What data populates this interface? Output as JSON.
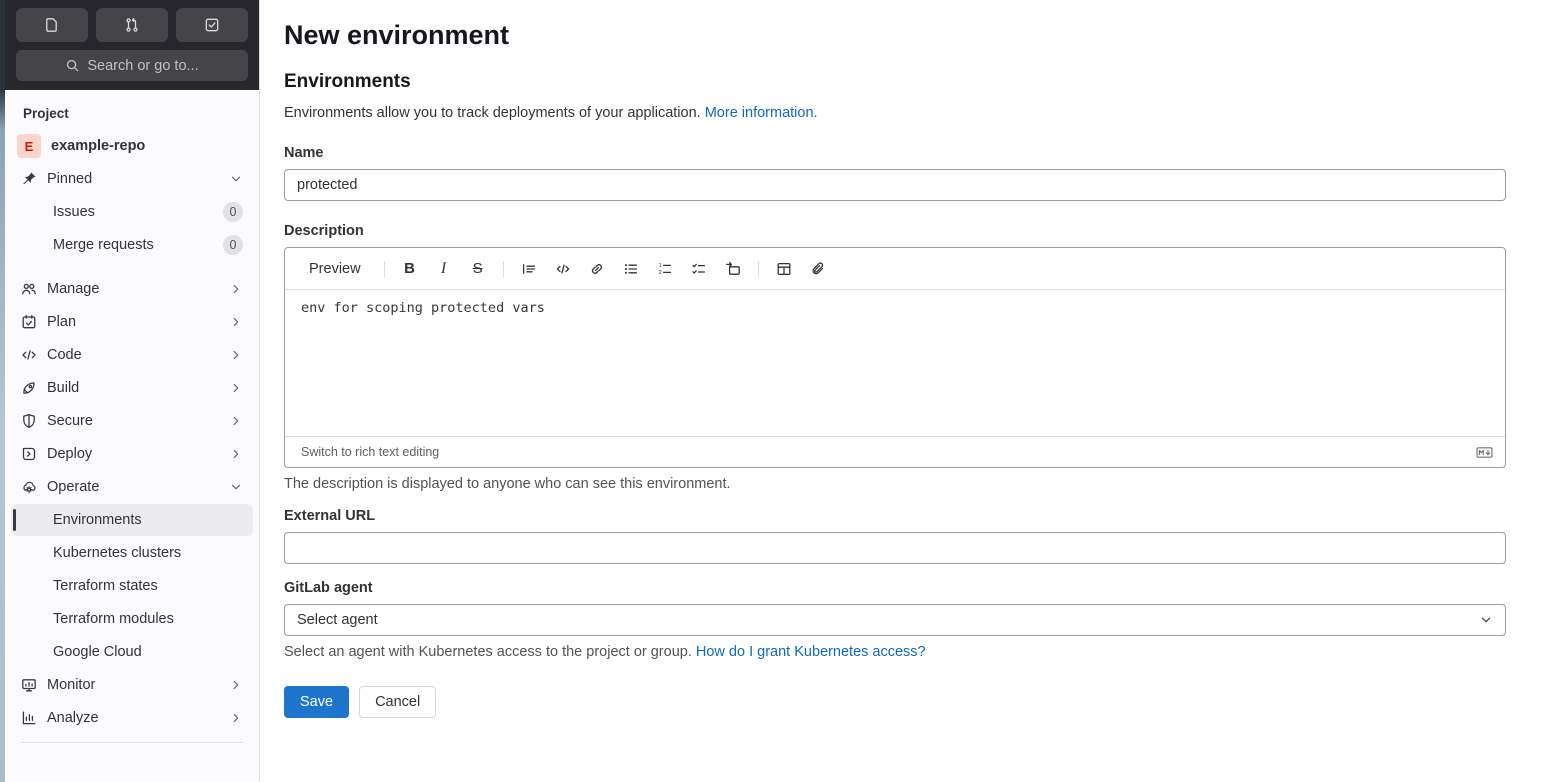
{
  "colors": {
    "accent_blue": "#1f75cb",
    "link_blue": "#1068bf",
    "sidebar_header_bg": "#28272d",
    "sidebar_bg": "#fbfafd",
    "active_item_bg": "#ececef",
    "avatar_bg": "#fdd4cc",
    "avatar_text": "#c91c00"
  },
  "sidebar": {
    "shortcuts": [
      {
        "icon": "issues-icon"
      },
      {
        "icon": "merge-request-icon"
      },
      {
        "icon": "todo-icon"
      }
    ],
    "search": {
      "icon": "search-icon",
      "placeholder": "Search or go to..."
    },
    "section_label": "Project",
    "project": {
      "avatar_letter": "E",
      "name": "example-repo"
    },
    "pinned": {
      "icon": "pin-icon",
      "label": "Pinned"
    },
    "pinned_items": [
      {
        "label": "Issues",
        "badge": "0"
      },
      {
        "label": "Merge requests",
        "badge": "0"
      }
    ],
    "nav": [
      {
        "icon": "users-icon",
        "label": "Manage"
      },
      {
        "icon": "calendar-icon",
        "label": "Plan"
      },
      {
        "icon": "code-icon",
        "label": "Code"
      },
      {
        "icon": "rocket-icon",
        "label": "Build"
      },
      {
        "icon": "shield-icon",
        "label": "Secure"
      },
      {
        "icon": "deploy-icon",
        "label": "Deploy"
      },
      {
        "icon": "cloud-gear-icon",
        "label": "Operate"
      }
    ],
    "operate_items": [
      {
        "label": "Environments",
        "active": true
      },
      {
        "label": "Kubernetes clusters"
      },
      {
        "label": "Terraform states"
      },
      {
        "label": "Terraform modules"
      },
      {
        "label": "Google Cloud"
      }
    ],
    "nav_bottom": [
      {
        "icon": "monitor-icon",
        "label": "Monitor"
      },
      {
        "icon": "chart-icon",
        "label": "Analyze"
      }
    ]
  },
  "main": {
    "title": "New environment",
    "heading": "Environments",
    "intro": {
      "text": "Environments allow you to track deployments of your application.",
      "link": "More information."
    },
    "name_field": {
      "label": "Name",
      "value": "protected"
    },
    "description_field": {
      "label": "Description",
      "toolbar": {
        "preview": "Preview",
        "bold": "B",
        "italic": "I",
        "strike": "S"
      },
      "content": "env for scoping protected vars",
      "switch_label": "Switch to rich text editing",
      "help": "The description is displayed to anyone who can see this environment."
    },
    "external_url_field": {
      "label": "External URL",
      "value": ""
    },
    "agent_field": {
      "label": "GitLab agent",
      "value": "Select agent",
      "help": "Select an agent with Kubernetes access to the project or group.",
      "help_link": "How do I grant Kubernetes access?"
    },
    "actions": {
      "save": "Save",
      "cancel": "Cancel"
    }
  }
}
